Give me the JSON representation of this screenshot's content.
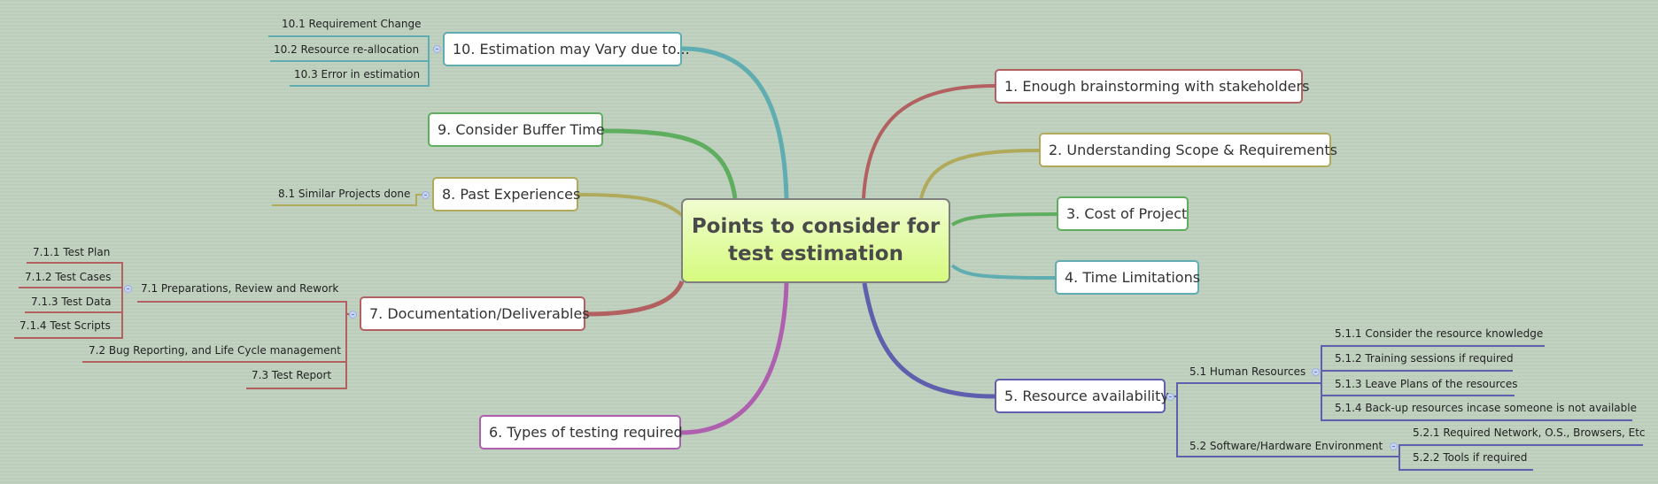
{
  "central": {
    "line1": "Points to consider for",
    "line2": "test estimation"
  },
  "colors": {
    "t1": "#b26060",
    "t2": "#b0aa5a",
    "t3": "#5fae5f",
    "t4": "#5fadb0",
    "t5": "#5f5fae",
    "t6": "#ae5fae",
    "t7": "#b26060",
    "t8": "#b0aa5a",
    "t9": "#5fae5f",
    "t10": "#5fadb0"
  },
  "topics": {
    "t1": "1. Enough brainstorming with stakeholders",
    "t2": "2. Understanding Scope & Requirements",
    "t3": "3. Cost of Project",
    "t4": "4. Time Limitations",
    "t5": "5. Resource availability",
    "t6": "6. Types of testing required",
    "t7": "7. Documentation/Deliverables",
    "t8": "8. Past Experiences",
    "t9": "9. Consider Buffer Time",
    "t10": "10. Estimation may Vary due to..."
  },
  "subtopics": {
    "s5_1": "5.1  Human Resources",
    "s5_1_1": "5.1.1  Consider the resource knowledge",
    "s5_1_2": "5.1.2  Training sessions if required",
    "s5_1_3": "5.1.3  Leave Plans of the resources",
    "s5_1_4": "5.1.4  Back-up resources incase someone is not available",
    "s5_2": "5.2  Software/Hardware Environment",
    "s5_2_1": "5.2.1  Required Network, O.S., Browsers, Etc",
    "s5_2_2": "5.2.2  Tools if required",
    "s7_1": "7.1  Preparations, Review and Rework",
    "s7_1_1": "7.1.1  Test Plan",
    "s7_1_2": "7.1.2  Test Cases",
    "s7_1_3": "7.1.3  Test Data",
    "s7_1_4": "7.1.4  Test Scripts",
    "s7_2": "7.2  Bug Reporting, and Life Cycle management",
    "s7_3": "7.3  Test Report",
    "s8_1": "8.1  Similar Projects done",
    "s10_1": "10.1  Requirement Change",
    "s10_2": "10.2  Resource re-allocation",
    "s10_3": "10.3  Error in estimation"
  }
}
